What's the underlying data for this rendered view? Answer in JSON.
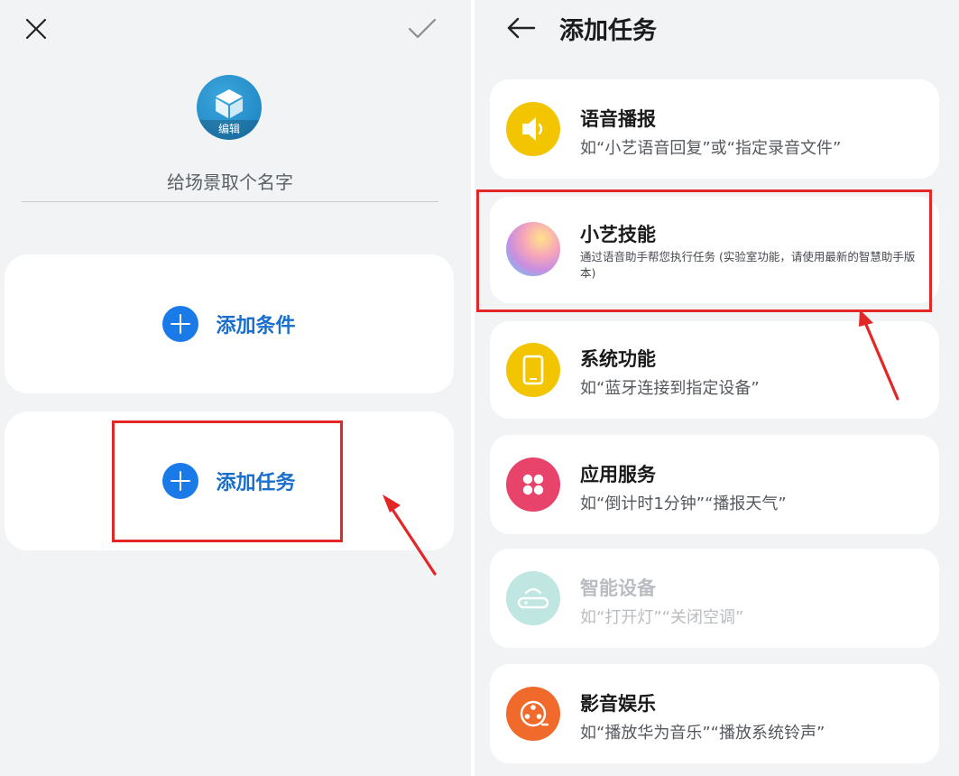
{
  "left": {
    "avatar_caption": "编辑",
    "name_placeholder": "给场景取个名字",
    "add_condition_label": "添加条件",
    "add_task_label": "添加任务"
  },
  "right": {
    "title": "添加任务",
    "tasks": [
      {
        "title": "语音播报",
        "desc": "如“小艺语音回复”或“指定录音文件”",
        "icon": "speaker-icon",
        "color": "#f2c500"
      },
      {
        "title": "小艺技能",
        "desc": "通过语音助手帮您执行任务 (实验室功能，请使用最新的智慧助手版本)",
        "icon": "xiaoyi-orb-icon",
        "color": "#c98ee0"
      },
      {
        "title": "系统功能",
        "desc": "如“蓝牙连接到指定设备”",
        "icon": "phone-icon",
        "color": "#f2c500"
      },
      {
        "title": "应用服务",
        "desc": "如“倒计时1分钟”“播报天气”",
        "icon": "apps-grid-icon",
        "color": "#e8436b"
      },
      {
        "title": "智能设备",
        "desc": "如“打开灯”“关闭空调”",
        "icon": "router-icon",
        "color": "#bfe6e0"
      },
      {
        "title": "影音娱乐",
        "desc": "如“播放华为音乐”“播放系统铃声”",
        "icon": "film-reel-icon",
        "color": "#ef6a2b"
      }
    ]
  },
  "colors": {
    "accent_blue": "#1a7ae8",
    "highlight_red": "#e32626",
    "panel_bg": "#f1f3f5"
  }
}
